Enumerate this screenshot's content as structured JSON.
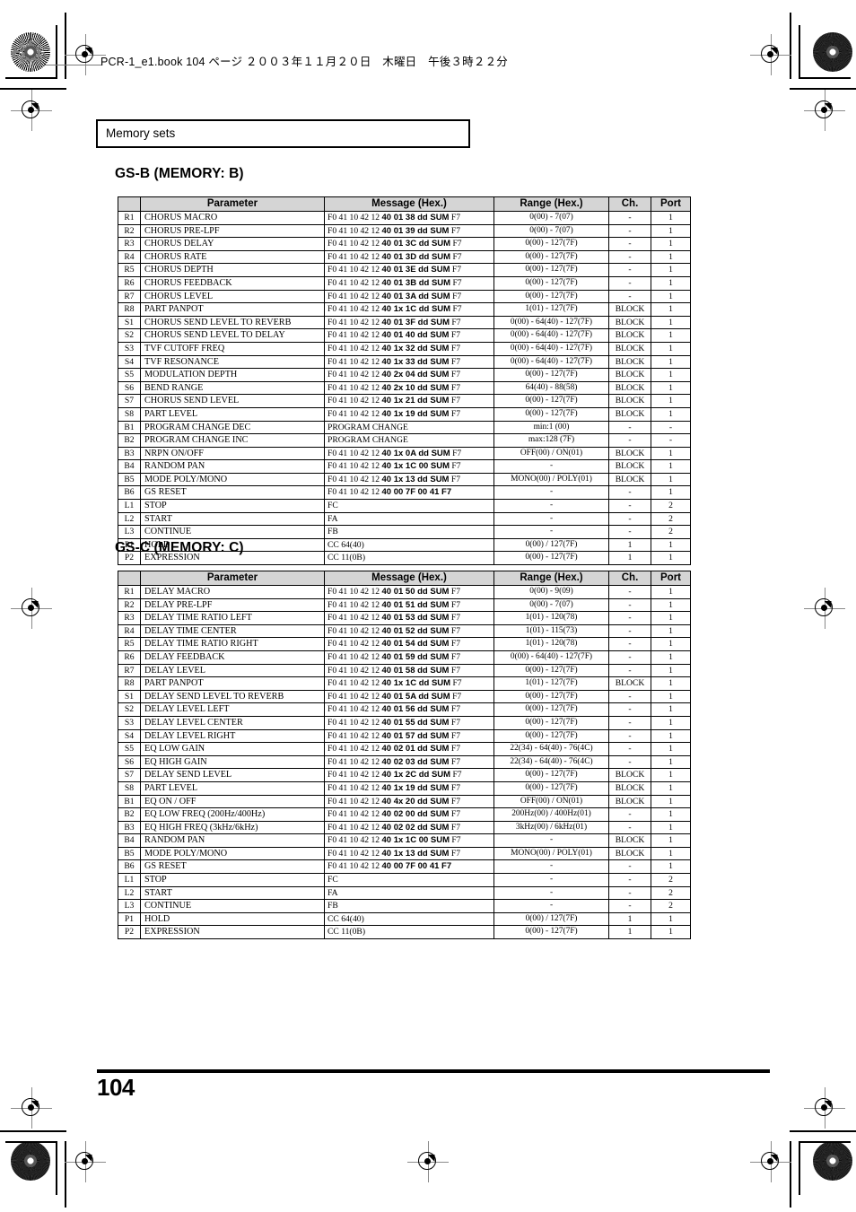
{
  "page": {
    "header_line": "PCR-1_e1.book  104 ページ  ２００３年１１月２０日　木曜日　午後３時２２分",
    "section_banner": "Memory sets",
    "page_number": "104"
  },
  "columns": [
    "",
    "Parameter",
    "Message (Hex.)",
    "Range (Hex.)",
    "Ch.",
    "Port"
  ],
  "sections": [
    {
      "title": "GS-B (MEMORY: B)",
      "rows": [
        {
          "id": "R1",
          "parameter": "CHORUS MACRO",
          "msg_pre": "F0 41 10 42 12 ",
          "msg_bold": "40 01 38 dd SUM",
          "msg_post": " F7",
          "range": "0(00) - 7(07)",
          "ch": "-",
          "port": "1"
        },
        {
          "id": "R2",
          "parameter": "CHORUS PRE-LPF",
          "msg_pre": "F0 41 10 42 12 ",
          "msg_bold": "40 01 39 dd SUM",
          "msg_post": " F7",
          "range": "0(00) - 7(07)",
          "ch": "-",
          "port": "1"
        },
        {
          "id": "R3",
          "parameter": "CHORUS DELAY",
          "msg_pre": "F0 41 10 42 12 ",
          "msg_bold": "40 01 3C dd SUM",
          "msg_post": " F7",
          "range": "0(00) - 127(7F)",
          "ch": "-",
          "port": "1"
        },
        {
          "id": "R4",
          "parameter": "CHORUS RATE",
          "msg_pre": "F0 41 10 42 12 ",
          "msg_bold": "40 01 3D dd SUM",
          "msg_post": " F7",
          "range": "0(00) - 127(7F)",
          "ch": "-",
          "port": "1"
        },
        {
          "id": "R5",
          "parameter": "CHORUS DEPTH",
          "msg_pre": "F0 41 10 42 12 ",
          "msg_bold": "40 01 3E dd SUM",
          "msg_post": " F7",
          "range": "0(00) - 127(7F)",
          "ch": "-",
          "port": "1"
        },
        {
          "id": "R6",
          "parameter": "CHORUS FEEDBACK",
          "msg_pre": "F0 41 10 42 12 ",
          "msg_bold": "40 01 3B dd SUM",
          "msg_post": " F7",
          "range": "0(00) - 127(7F)",
          "ch": "-",
          "port": "1"
        },
        {
          "id": "R7",
          "parameter": "CHORUS LEVEL",
          "msg_pre": "F0 41 10 42 12 ",
          "msg_bold": "40 01 3A dd SUM",
          "msg_post": " F7",
          "range": "0(00) - 127(7F)",
          "ch": "-",
          "port": "1"
        },
        {
          "id": "R8",
          "parameter": "PART PANPOT",
          "msg_pre": "F0 41 10 42 12 ",
          "msg_bold": "40 1x 1C dd SUM",
          "msg_post": " F7",
          "range": "1(01) - 127(7F)",
          "ch": "BLOCK",
          "port": "1"
        },
        {
          "id": "S1",
          "parameter": "CHORUS SEND LEVEL TO REVERB",
          "msg_pre": "F0 41 10 42 12 ",
          "msg_bold": "40 01 3F dd SUM",
          "msg_post": " F7",
          "range": "0(00) - 64(40) - 127(7F)",
          "ch": "BLOCK",
          "port": "1"
        },
        {
          "id": "S2",
          "parameter": "CHORUS SEND LEVEL TO DELAY",
          "msg_pre": "F0 41 10 42 12 ",
          "msg_bold": "40 01 40 dd SUM",
          "msg_post": " F7",
          "range": "0(00) - 64(40) - 127(7F)",
          "ch": "BLOCK",
          "port": "1"
        },
        {
          "id": "S3",
          "parameter": "TVF CUTOFF FREQ",
          "msg_pre": "F0 41 10 42 12 ",
          "msg_bold": "40 1x 32 dd SUM",
          "msg_post": " F7",
          "range": "0(00) - 64(40) - 127(7F)",
          "ch": "BLOCK",
          "port": "1"
        },
        {
          "id": "S4",
          "parameter": "TVF RESONANCE",
          "msg_pre": "F0 41 10 42 12 ",
          "msg_bold": "40 1x 33 dd SUM",
          "msg_post": " F7",
          "range": "0(00) - 64(40) - 127(7F)",
          "ch": "BLOCK",
          "port": "1"
        },
        {
          "id": "S5",
          "parameter": "MODULATION DEPTH",
          "msg_pre": "F0 41 10 42 12 ",
          "msg_bold": "40 2x 04 dd SUM",
          "msg_post": " F7",
          "range": "0(00) - 127(7F)",
          "ch": "BLOCK",
          "port": "1"
        },
        {
          "id": "S6",
          "parameter": "BEND RANGE",
          "msg_pre": "F0 41 10 42 12 ",
          "msg_bold": "40 2x 10 dd SUM",
          "msg_post": " F7",
          "range": "64(40) - 88(58)",
          "ch": "BLOCK",
          "port": "1"
        },
        {
          "id": "S7",
          "parameter": "CHORUS SEND LEVEL",
          "msg_pre": "F0 41 10 42 12 ",
          "msg_bold": "40 1x 21 dd SUM",
          "msg_post": " F7",
          "range": "0(00) - 127(7F)",
          "ch": "BLOCK",
          "port": "1"
        },
        {
          "id": "S8",
          "parameter": "PART LEVEL",
          "msg_pre": "F0 41 10 42 12 ",
          "msg_bold": "40 1x 19 dd SUM",
          "msg_post": " F7",
          "range": "0(00) - 127(7F)",
          "ch": "BLOCK",
          "port": "1"
        },
        {
          "id": "B1",
          "parameter": "PROGRAM CHANGE DEC",
          "msg_pre": "PROGRAM CHANGE",
          "msg_bold": "",
          "msg_post": "",
          "range": "min:1 (00)",
          "ch": "-",
          "port": "-"
        },
        {
          "id": "B2",
          "parameter": "PROGRAM CHANGE INC",
          "msg_pre": "PROGRAM CHANGE",
          "msg_bold": "",
          "msg_post": "",
          "range": "max:128 (7F)",
          "ch": "-",
          "port": "-"
        },
        {
          "id": "B3",
          "parameter": "NRPN ON/OFF",
          "msg_pre": "F0 41 10 42 12 ",
          "msg_bold": "40 1x 0A dd SUM",
          "msg_post": " F7",
          "range": "OFF(00) / ON(01)",
          "ch": "BLOCK",
          "port": "1"
        },
        {
          "id": "B4",
          "parameter": "RANDOM PAN",
          "msg_pre": "F0 41 10 42 12 ",
          "msg_bold": "40 1x 1C 00 SUM",
          "msg_post": " F7",
          "range": "-",
          "ch": "BLOCK",
          "port": "1"
        },
        {
          "id": "B5",
          "parameter": "MODE POLY/MONO",
          "msg_pre": "F0 41 10 42 12 ",
          "msg_bold": "40 1x 13 dd SUM",
          "msg_post": " F7",
          "range": "MONO(00) / POLY(01)",
          "ch": "BLOCK",
          "port": "1"
        },
        {
          "id": "B6",
          "parameter": "GS RESET",
          "msg_pre": "F0 41 10 42 12 ",
          "msg_bold": "40 00 7F 00 41 F7",
          "msg_post": "",
          "range": "-",
          "ch": "-",
          "port": "1"
        },
        {
          "id": "L1",
          "parameter": "STOP",
          "msg_pre": "FC",
          "msg_bold": "",
          "msg_post": "",
          "range": "-",
          "ch": "-",
          "port": "2"
        },
        {
          "id": "L2",
          "parameter": "START",
          "msg_pre": "FA",
          "msg_bold": "",
          "msg_post": "",
          "range": "-",
          "ch": "-",
          "port": "2"
        },
        {
          "id": "L3",
          "parameter": "CONTINUE",
          "msg_pre": "FB",
          "msg_bold": "",
          "msg_post": "",
          "range": "-",
          "ch": "-",
          "port": "2"
        },
        {
          "id": "P1",
          "parameter": "HOLD",
          "msg_pre": "CC 64(40)",
          "msg_bold": "",
          "msg_post": "",
          "range": "0(00) / 127(7F)",
          "ch": "1",
          "port": "1"
        },
        {
          "id": "P2",
          "parameter": "EXPRESSION",
          "msg_pre": "CC 11(0B)",
          "msg_bold": "",
          "msg_post": "",
          "range": "0(00) - 127(7F)",
          "ch": "1",
          "port": "1"
        }
      ]
    },
    {
      "title": "GS-C (MEMORY: C)",
      "rows": [
        {
          "id": "R1",
          "parameter": "DELAY MACRO",
          "msg_pre": "F0 41 10 42 12 ",
          "msg_bold": "40 01 50 dd SUM",
          "msg_post": " F7",
          "range": "0(00) - 9(09)",
          "ch": "-",
          "port": "1"
        },
        {
          "id": "R2",
          "parameter": "DELAY PRE-LPF",
          "msg_pre": "F0 41 10 42 12 ",
          "msg_bold": "40 01 51 dd SUM",
          "msg_post": " F7",
          "range": "0(00) - 7(07)",
          "ch": "-",
          "port": "1"
        },
        {
          "id": "R3",
          "parameter": "DELAY TIME RATIO LEFT",
          "msg_pre": "F0 41 10 42 12 ",
          "msg_bold": "40 01 53 dd SUM",
          "msg_post": " F7",
          "range": "1(01) - 120(78)",
          "ch": "-",
          "port": "1"
        },
        {
          "id": "R4",
          "parameter": "DELAY TIME CENTER",
          "msg_pre": "F0 41 10 42 12 ",
          "msg_bold": "40 01 52 dd SUM",
          "msg_post": " F7",
          "range": "1(01) - 115(73)",
          "ch": "-",
          "port": "1"
        },
        {
          "id": "R5",
          "parameter": "DELAY TIME RATIO RIGHT",
          "msg_pre": "F0 41 10 42 12 ",
          "msg_bold": "40 01 54 dd SUM",
          "msg_post": " F7",
          "range": "1(01) - 120(78)",
          "ch": "-",
          "port": "1"
        },
        {
          "id": "R6",
          "parameter": "DELAY FEEDBACK",
          "msg_pre": "F0 41 10 42 12 ",
          "msg_bold": "40 01 59 dd SUM",
          "msg_post": " F7",
          "range": "0(00) - 64(40) - 127(7F)",
          "ch": "-",
          "port": "1"
        },
        {
          "id": "R7",
          "parameter": "DELAY LEVEL",
          "msg_pre": "F0 41 10 42 12 ",
          "msg_bold": "40 01 58 dd SUM",
          "msg_post": " F7",
          "range": "0(00) - 127(7F)",
          "ch": "-",
          "port": "1"
        },
        {
          "id": "R8",
          "parameter": "PART PANPOT",
          "msg_pre": "F0 41 10 42 12 ",
          "msg_bold": "40 1x 1C dd SUM",
          "msg_post": " F7",
          "range": "1(01) - 127(7F)",
          "ch": "BLOCK",
          "port": "1"
        },
        {
          "id": "S1",
          "parameter": "DELAY SEND LEVEL TO REVERB",
          "msg_pre": "F0 41 10 42 12 ",
          "msg_bold": "40 01 5A dd SUM",
          "msg_post": " F7",
          "range": "0(00) - 127(7F)",
          "ch": "-",
          "port": "1"
        },
        {
          "id": "S2",
          "parameter": "DELAY LEVEL LEFT",
          "msg_pre": "F0 41 10 42 12 ",
          "msg_bold": "40 01 56 dd SUM",
          "msg_post": " F7",
          "range": "0(00) - 127(7F)",
          "ch": "-",
          "port": "1"
        },
        {
          "id": "S3",
          "parameter": "DELAY LEVEL CENTER",
          "msg_pre": "F0 41 10 42 12 ",
          "msg_bold": "40 01 55 dd SUM",
          "msg_post": " F7",
          "range": "0(00) - 127(7F)",
          "ch": "-",
          "port": "1"
        },
        {
          "id": "S4",
          "parameter": "DELAY LEVEL RIGHT",
          "msg_pre": "F0 41 10 42 12 ",
          "msg_bold": "40 01 57 dd SUM",
          "msg_post": " F7",
          "range": "0(00) - 127(7F)",
          "ch": "-",
          "port": "1"
        },
        {
          "id": "S5",
          "parameter": "EQ LOW GAIN",
          "msg_pre": "F0 41 10 42 12 ",
          "msg_bold": "40 02 01 dd SUM",
          "msg_post": " F7",
          "range": "22(34) - 64(40) - 76(4C)",
          "ch": "-",
          "port": "1"
        },
        {
          "id": "S6",
          "parameter": "EQ HIGH GAIN",
          "msg_pre": "F0 41 10 42 12 ",
          "msg_bold": "40 02 03 dd SUM",
          "msg_post": " F7",
          "range": "22(34) - 64(40) - 76(4C)",
          "ch": "-",
          "port": "1"
        },
        {
          "id": "S7",
          "parameter": "DELAY SEND LEVEL",
          "msg_pre": "F0 41 10 42 12 ",
          "msg_bold": "40 1x 2C dd SUM",
          "msg_post": " F7",
          "range": "0(00) - 127(7F)",
          "ch": "BLOCK",
          "port": "1"
        },
        {
          "id": "S8",
          "parameter": "PART LEVEL",
          "msg_pre": "F0 41 10 42 12 ",
          "msg_bold": "40 1x 19 dd SUM",
          "msg_post": " F7",
          "range": "0(00) - 127(7F)",
          "ch": "BLOCK",
          "port": "1"
        },
        {
          "id": "B1",
          "parameter": "EQ ON / OFF",
          "msg_pre": "F0 41 10 42 12 ",
          "msg_bold": "40 4x 20 dd SUM",
          "msg_post": " F7",
          "range": "OFF(00) / ON(01)",
          "ch": "BLOCK",
          "port": "1"
        },
        {
          "id": "B2",
          "parameter": "EQ LOW FREQ (200Hz/400Hz)",
          "msg_pre": "F0 41 10 42 12 ",
          "msg_bold": "40 02 00 dd SUM",
          "msg_post": " F7",
          "range": "200Hz(00) / 400Hz(01)",
          "ch": "-",
          "port": "1"
        },
        {
          "id": "B3",
          "parameter": "EQ HIGH FREQ (3kHz/6kHz)",
          "msg_pre": "F0 41 10 42 12 ",
          "msg_bold": "40 02 02 dd SUM",
          "msg_post": " F7",
          "range": "3kHz(00) / 6kHz(01)",
          "ch": "-",
          "port": "1"
        },
        {
          "id": "B4",
          "parameter": "RANDOM PAN",
          "msg_pre": "F0 41 10 42 12 ",
          "msg_bold": "40 1x 1C 00 SUM",
          "msg_post": " F7",
          "range": "-",
          "ch": "BLOCK",
          "port": "1"
        },
        {
          "id": "B5",
          "parameter": "MODE POLY/MONO",
          "msg_pre": "F0 41 10 42 12 ",
          "msg_bold": "40 1x 13 dd SUM",
          "msg_post": " F7",
          "range": "MONO(00) / POLY(01)",
          "ch": "BLOCK",
          "port": "1"
        },
        {
          "id": "B6",
          "parameter": "GS RESET",
          "msg_pre": "F0 41 10 42 12 ",
          "msg_bold": "40 00 7F 00 41 F7",
          "msg_post": "",
          "range": "-",
          "ch": "-",
          "port": "1"
        },
        {
          "id": "L1",
          "parameter": "STOP",
          "msg_pre": "FC",
          "msg_bold": "",
          "msg_post": "",
          "range": "-",
          "ch": "-",
          "port": "2"
        },
        {
          "id": "L2",
          "parameter": "START",
          "msg_pre": "FA",
          "msg_bold": "",
          "msg_post": "",
          "range": "-",
          "ch": "-",
          "port": "2"
        },
        {
          "id": "L3",
          "parameter": "CONTINUE",
          "msg_pre": "FB",
          "msg_bold": "",
          "msg_post": "",
          "range": "-",
          "ch": "-",
          "port": "2"
        },
        {
          "id": "P1",
          "parameter": "HOLD",
          "msg_pre": "CC 64(40)",
          "msg_bold": "",
          "msg_post": "",
          "range": "0(00) / 127(7F)",
          "ch": "1",
          "port": "1"
        },
        {
          "id": "P2",
          "parameter": "EXPRESSION",
          "msg_pre": "CC 11(0B)",
          "msg_bold": "",
          "msg_post": "",
          "range": "0(00) - 127(7F)",
          "ch": "1",
          "port": "1"
        }
      ]
    }
  ]
}
